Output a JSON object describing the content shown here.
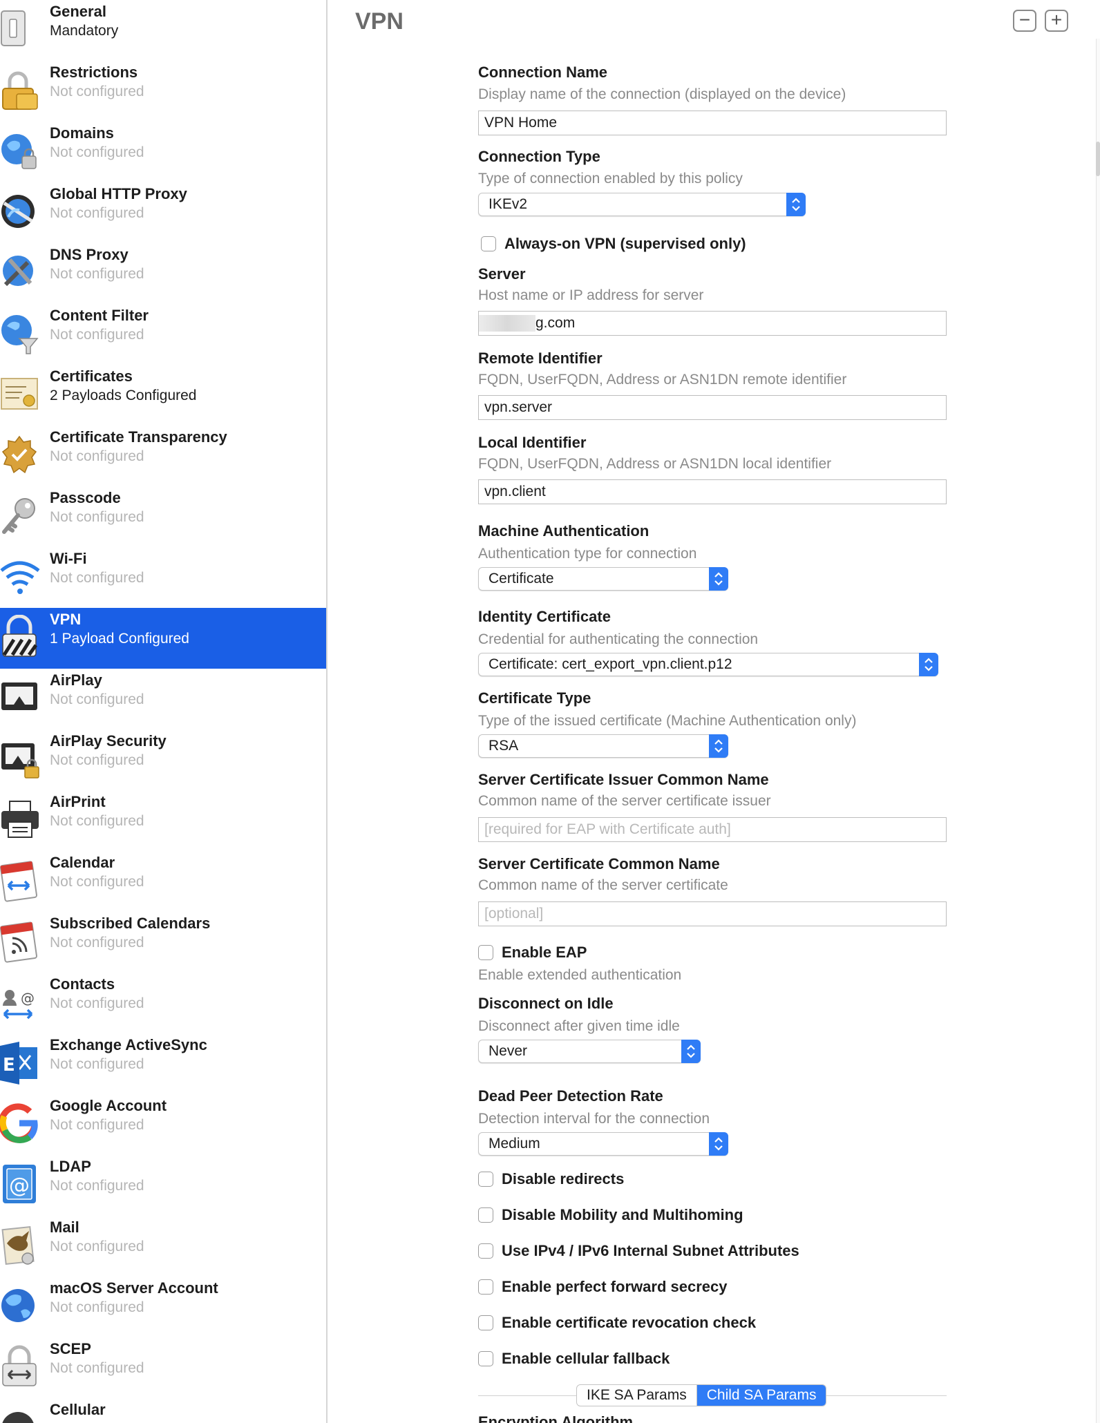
{
  "sidebar": {
    "items": [
      {
        "title": "General",
        "subtitle": "Mandatory",
        "icon": "general-switch-icon",
        "configured": true
      },
      {
        "title": "Restrictions",
        "subtitle": "Not configured",
        "icon": "padlock-icon",
        "configured": false
      },
      {
        "title": "Domains",
        "subtitle": "Not configured",
        "icon": "globe-lock-icon",
        "configured": false
      },
      {
        "title": "Global HTTP Proxy",
        "subtitle": "Not configured",
        "icon": "globe-proxy-icon",
        "configured": false
      },
      {
        "title": "DNS Proxy",
        "subtitle": "Not configured",
        "icon": "globe-tools-icon",
        "configured": false
      },
      {
        "title": "Content Filter",
        "subtitle": "Not configured",
        "icon": "globe-filter-icon",
        "configured": false
      },
      {
        "title": "Certificates",
        "subtitle": "2 Payloads Configured",
        "icon": "certificate-icon",
        "configured": true
      },
      {
        "title": "Certificate Transparency",
        "subtitle": "Not configured",
        "icon": "certificate-seal-icon",
        "configured": false
      },
      {
        "title": "Passcode",
        "subtitle": "Not configured",
        "icon": "key-icon",
        "configured": false
      },
      {
        "title": "Wi-Fi",
        "subtitle": "Not configured",
        "icon": "wifi-icon",
        "configured": false
      },
      {
        "title": "VPN",
        "subtitle": "1 Payload Configured",
        "icon": "vpn-lock-icon",
        "configured": true,
        "selected": true
      },
      {
        "title": "AirPlay",
        "subtitle": "Not configured",
        "icon": "airplay-icon",
        "configured": false
      },
      {
        "title": "AirPlay Security",
        "subtitle": "Not configured",
        "icon": "airplay-security-icon",
        "configured": false
      },
      {
        "title": "AirPrint",
        "subtitle": "Not configured",
        "icon": "printer-icon",
        "configured": false
      },
      {
        "title": "Calendar",
        "subtitle": "Not configured",
        "icon": "calendar-icon",
        "configured": false
      },
      {
        "title": "Subscribed Calendars",
        "subtitle": "Not configured",
        "icon": "subscribed-calendar-icon",
        "configured": false
      },
      {
        "title": "Contacts",
        "subtitle": "Not configured",
        "icon": "contacts-icon",
        "configured": false
      },
      {
        "title": "Exchange ActiveSync",
        "subtitle": "Not configured",
        "icon": "exchange-icon",
        "configured": false
      },
      {
        "title": "Google Account",
        "subtitle": "Not configured",
        "icon": "google-icon",
        "configured": false
      },
      {
        "title": "LDAP",
        "subtitle": "Not configured",
        "icon": "ldap-icon",
        "configured": false
      },
      {
        "title": "Mail",
        "subtitle": "Not configured",
        "icon": "mail-icon",
        "configured": false
      },
      {
        "title": "macOS Server Account",
        "subtitle": "Not configured",
        "icon": "server-globe-icon",
        "configured": false
      },
      {
        "title": "SCEP",
        "subtitle": "Not configured",
        "icon": "scep-lock-icon",
        "configured": false
      },
      {
        "title": "Cellular",
        "subtitle": "",
        "icon": "cellular-icon",
        "configured": false
      }
    ]
  },
  "main": {
    "title": "VPN",
    "remove_label": "−",
    "add_label": "+",
    "connection_name": {
      "label": "Connection Name",
      "desc": "Display name of the connection (displayed on the device)",
      "value": "VPN Home"
    },
    "connection_type": {
      "label": "Connection Type",
      "desc": "Type of connection enabled by this policy",
      "value": "IKEv2"
    },
    "always_on": {
      "label": "Always-on VPN (supervised only)"
    },
    "server": {
      "label": "Server",
      "desc": "Host name or IP address for server",
      "value": "g.com"
    },
    "remote_identifier": {
      "label": "Remote Identifier",
      "desc": "FQDN, UserFQDN, Address or ASN1DN remote identifier",
      "value": "vpn.server"
    },
    "local_identifier": {
      "label": "Local Identifier",
      "desc": "FQDN, UserFQDN, Address or ASN1DN local identifier",
      "value": "vpn.client"
    },
    "machine_auth": {
      "label": "Machine Authentication",
      "desc": "Authentication type for connection",
      "value": "Certificate"
    },
    "identity_cert": {
      "label": "Identity Certificate",
      "desc": "Credential for authenticating the connection",
      "value": "Certificate: cert_export_vpn.client.p12"
    },
    "cert_type": {
      "label": "Certificate Type",
      "desc": "Type of the issued certificate (Machine Authentication only)",
      "value": "RSA"
    },
    "server_issuer_cn": {
      "label": "Server Certificate Issuer Common Name",
      "desc": "Common name of the server certificate issuer",
      "placeholder": "[required for EAP with Certificate auth]"
    },
    "server_cn": {
      "label": "Server Certificate Common Name",
      "desc": "Common name of the server certificate",
      "placeholder": "[optional]"
    },
    "enable_eap": {
      "label": "Enable EAP",
      "desc": "Enable extended authentication"
    },
    "disconnect_idle": {
      "label": "Disconnect on Idle",
      "desc": "Disconnect after given time idle",
      "value": "Never"
    },
    "dpd_rate": {
      "label": "Dead Peer Detection Rate",
      "desc": "Detection interval for the connection",
      "value": "Medium"
    },
    "checks": {
      "disable_redirects": "Disable redirects",
      "disable_mobility": "Disable Mobility and Multihoming",
      "ipv4_ipv6": "Use IPv4 / IPv6 Internal Subnet Attributes",
      "pfs": "Enable perfect forward secrecy",
      "revocation": "Enable certificate revocation check",
      "cellular_fallback": "Enable cellular fallback"
    },
    "tabs": {
      "ike": "IKE SA Params",
      "child": "Child SA Params"
    },
    "cut_off_label": "Encryption Algorithm"
  },
  "colors": {
    "selection": "#1a5fe6",
    "accent": "#2f7cf6",
    "muted_text": "#b5b5b5"
  }
}
